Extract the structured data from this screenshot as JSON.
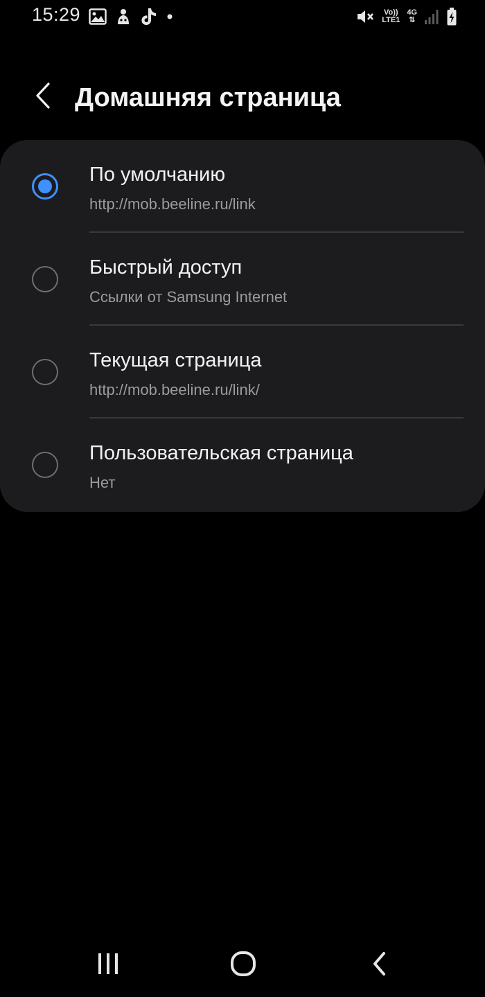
{
  "status_bar": {
    "time": "15:29",
    "left_icons": [
      "gallery-icon",
      "app-notification-icon",
      "tiktok-icon",
      "more-notifications-dot-icon"
    ],
    "volte_label_top": "Vo))",
    "volte_label_bottom": "LTE1",
    "network_label": "4G",
    "right_icons": [
      "mute-icon",
      "volte-icon",
      "network-4g-icon",
      "signal-icon",
      "battery-charging-icon"
    ]
  },
  "app_bar": {
    "title": "Домашняя страница",
    "back_icon": "chevron-left-icon"
  },
  "options": [
    {
      "title": "По умолчанию",
      "subtitle": "http://mob.beeline.ru/link",
      "selected": true
    },
    {
      "title": "Быстрый доступ",
      "subtitle": "Ссылки от Samsung Internet",
      "selected": false
    },
    {
      "title": "Текущая страница",
      "subtitle": "http://mob.beeline.ru/link/",
      "selected": false
    },
    {
      "title": "Пользовательская страница",
      "subtitle": "Нет",
      "selected": false
    }
  ],
  "nav_bar": {
    "icons": [
      "recent-apps-icon",
      "home-icon",
      "back-icon"
    ]
  },
  "colors": {
    "background": "#000000",
    "card": "#1c1c1e",
    "accent": "#3e91ff",
    "title_text": "#f2f2f2",
    "subtitle_text": "#9b9b9f",
    "divider": "#3a3a3c"
  }
}
